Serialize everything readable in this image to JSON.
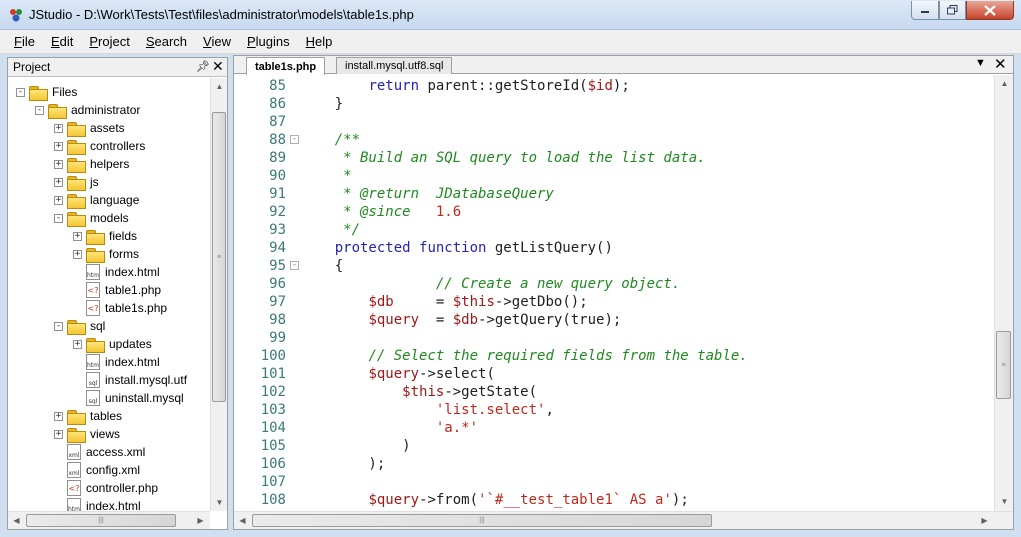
{
  "window": {
    "title": "JStudio - D:\\Work\\Tests\\Test\\files\\administrator\\models\\table1s.php"
  },
  "menu": [
    "File",
    "Edit",
    "Project",
    "Search",
    "View",
    "Plugins",
    "Help"
  ],
  "project_panel": {
    "title": "Project",
    "tree": [
      {
        "label": "Files",
        "type": "folder",
        "depth": 0,
        "expander": "-"
      },
      {
        "label": "administrator",
        "type": "folder",
        "depth": 1,
        "expander": "-"
      },
      {
        "label": "assets",
        "type": "folder",
        "depth": 2,
        "expander": "+"
      },
      {
        "label": "controllers",
        "type": "folder",
        "depth": 2,
        "expander": "+"
      },
      {
        "label": "helpers",
        "type": "folder",
        "depth": 2,
        "expander": "+"
      },
      {
        "label": "js",
        "type": "folder",
        "depth": 2,
        "expander": "+"
      },
      {
        "label": "language",
        "type": "folder",
        "depth": 2,
        "expander": "+"
      },
      {
        "label": "models",
        "type": "folder",
        "depth": 2,
        "expander": "-"
      },
      {
        "label": "fields",
        "type": "folder",
        "depth": 3,
        "expander": "+"
      },
      {
        "label": "forms",
        "type": "folder",
        "depth": 3,
        "expander": "+"
      },
      {
        "label": "index.html",
        "type": "html",
        "depth": 3,
        "expander": ""
      },
      {
        "label": "table1.php",
        "type": "php",
        "depth": 3,
        "expander": ""
      },
      {
        "label": "table1s.php",
        "type": "php",
        "depth": 3,
        "expander": ""
      },
      {
        "label": "sql",
        "type": "folder",
        "depth": 2,
        "expander": "-"
      },
      {
        "label": "updates",
        "type": "folder",
        "depth": 3,
        "expander": "+"
      },
      {
        "label": "index.html",
        "type": "html",
        "depth": 3,
        "expander": ""
      },
      {
        "label": "install.mysql.utf",
        "type": "sql",
        "depth": 3,
        "expander": ""
      },
      {
        "label": "uninstall.mysql",
        "type": "sql",
        "depth": 3,
        "expander": ""
      },
      {
        "label": "tables",
        "type": "folder",
        "depth": 2,
        "expander": "+"
      },
      {
        "label": "views",
        "type": "folder",
        "depth": 2,
        "expander": "+"
      },
      {
        "label": "access.xml",
        "type": "xml",
        "depth": 2,
        "expander": ""
      },
      {
        "label": "config.xml",
        "type": "xml",
        "depth": 2,
        "expander": ""
      },
      {
        "label": "controller.php",
        "type": "php",
        "depth": 2,
        "expander": ""
      },
      {
        "label": "index.html",
        "type": "html",
        "depth": 2,
        "expander": ""
      }
    ]
  },
  "editor": {
    "tabs": [
      {
        "label": "table1s.php",
        "active": true
      },
      {
        "label": "install.mysql.utf8.sql",
        "active": false
      }
    ],
    "lines": [
      {
        "num": "85",
        "fold": "",
        "tokens": [
          [
            "        ",
            ""
          ],
          [
            "return",
            "kw"
          ],
          [
            " parent::getStoreId(",
            "fn"
          ],
          [
            "$id",
            "var"
          ],
          [
            ");",
            "fn"
          ]
        ]
      },
      {
        "num": "86",
        "fold": "",
        "tokens": [
          [
            "    }",
            "fn"
          ]
        ]
      },
      {
        "num": "87",
        "fold": "",
        "tokens": []
      },
      {
        "num": "88",
        "fold": "-",
        "tokens": [
          [
            "    /**",
            "cm"
          ]
        ]
      },
      {
        "num": "89",
        "fold": "",
        "tokens": [
          [
            "     * Build an SQL query to load the list data.",
            "cm"
          ]
        ]
      },
      {
        "num": "90",
        "fold": "",
        "tokens": [
          [
            "     *",
            "cm"
          ]
        ]
      },
      {
        "num": "91",
        "fold": "",
        "tokens": [
          [
            "     * @return  JDatabaseQuery",
            "cm"
          ]
        ]
      },
      {
        "num": "92",
        "fold": "",
        "tokens": [
          [
            "     * @since   ",
            "cm"
          ],
          [
            "1.6",
            "str"
          ]
        ]
      },
      {
        "num": "93",
        "fold": "",
        "tokens": [
          [
            "     */",
            "cm"
          ]
        ]
      },
      {
        "num": "94",
        "fold": "",
        "tokens": [
          [
            "    ",
            ""
          ],
          [
            "protected",
            "kw"
          ],
          [
            " ",
            ""
          ],
          [
            "function",
            "kw"
          ],
          [
            " getListQuery()",
            "fn"
          ]
        ]
      },
      {
        "num": "95",
        "fold": "-",
        "tokens": [
          [
            "    {",
            "fn"
          ]
        ]
      },
      {
        "num": "96",
        "fold": "",
        "tokens": [
          [
            "                ",
            ""
          ],
          [
            "// Create a new query object.",
            "cm"
          ]
        ]
      },
      {
        "num": "97",
        "fold": "",
        "tokens": [
          [
            "        ",
            ""
          ],
          [
            "$db",
            "var"
          ],
          [
            "     = ",
            "fn"
          ],
          [
            "$this",
            "var"
          ],
          [
            "->getDbo();",
            "fn"
          ]
        ]
      },
      {
        "num": "98",
        "fold": "",
        "tokens": [
          [
            "        ",
            ""
          ],
          [
            "$query",
            "var"
          ],
          [
            "  = ",
            "fn"
          ],
          [
            "$db",
            "var"
          ],
          [
            "->getQuery(true);",
            "fn"
          ]
        ]
      },
      {
        "num": "99",
        "fold": "",
        "tokens": []
      },
      {
        "num": "100",
        "fold": "",
        "tokens": [
          [
            "        ",
            ""
          ],
          [
            "// Select the required fields from the table.",
            "cm"
          ]
        ]
      },
      {
        "num": "101",
        "fold": "",
        "tokens": [
          [
            "        ",
            ""
          ],
          [
            "$query",
            "var"
          ],
          [
            "->select(",
            "fn"
          ]
        ]
      },
      {
        "num": "102",
        "fold": "",
        "tokens": [
          [
            "            ",
            ""
          ],
          [
            "$this",
            "var"
          ],
          [
            "->getState(",
            "fn"
          ]
        ]
      },
      {
        "num": "103",
        "fold": "",
        "tokens": [
          [
            "                ",
            ""
          ],
          [
            "'list.select'",
            "str"
          ],
          [
            ",",
            "fn"
          ]
        ]
      },
      {
        "num": "104",
        "fold": "",
        "tokens": [
          [
            "                ",
            ""
          ],
          [
            "'a.*'",
            "str"
          ]
        ]
      },
      {
        "num": "105",
        "fold": "",
        "tokens": [
          [
            "            )",
            "fn"
          ]
        ]
      },
      {
        "num": "106",
        "fold": "",
        "tokens": [
          [
            "        );",
            "fn"
          ]
        ]
      },
      {
        "num": "107",
        "fold": "",
        "tokens": []
      },
      {
        "num": "108",
        "fold": "",
        "tokens": [
          [
            "        ",
            ""
          ],
          [
            "$query",
            "var"
          ],
          [
            "->from(",
            "fn"
          ],
          [
            "'`#__test_table1` AS a'",
            "str"
          ],
          [
            ");",
            "fn"
          ]
        ]
      }
    ]
  },
  "colors": {
    "keyword": "#2424b0",
    "variable": "#a01818",
    "comment": "#1f8a1f",
    "string": "#c0281c",
    "line_number": "#3a7a78"
  }
}
